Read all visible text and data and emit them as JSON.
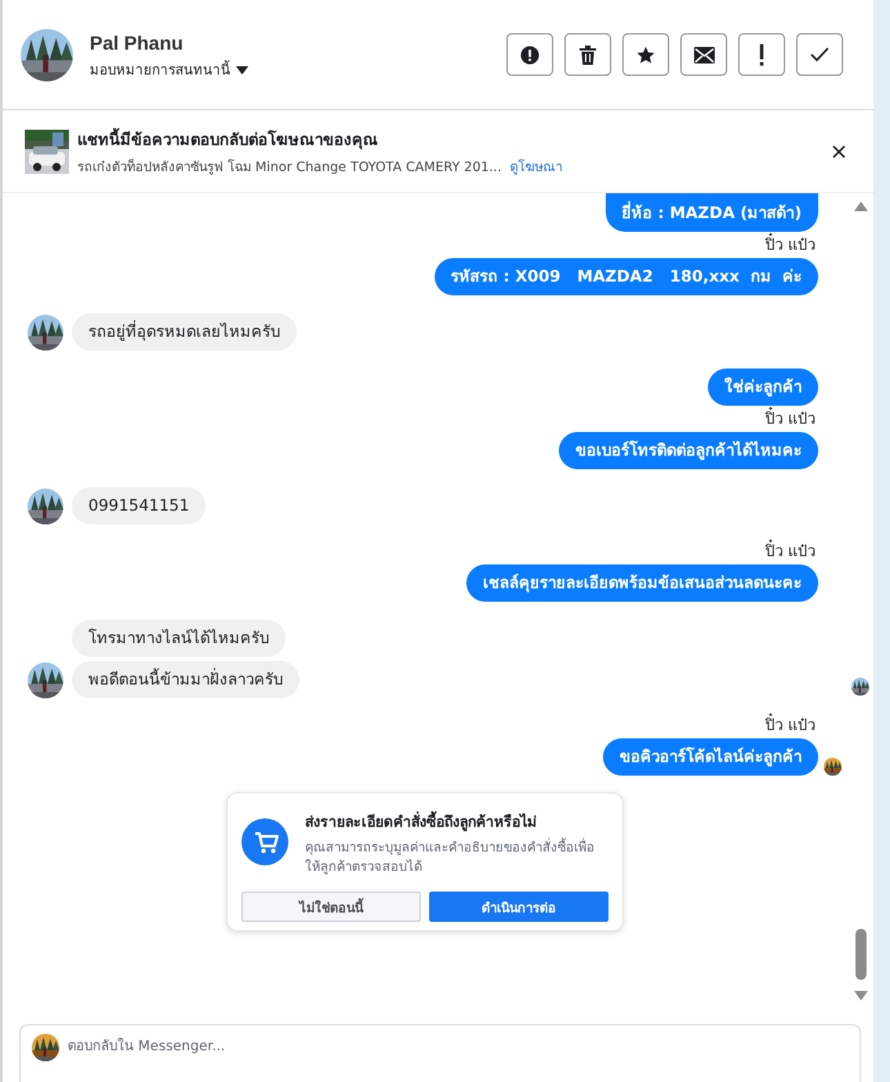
{
  "header": {
    "name": "Pal Phanu",
    "assign_label": "มอบหมายการสนทนานี้",
    "actions": [
      {
        "kind": "report"
      },
      {
        "kind": "delete"
      },
      {
        "kind": "star"
      },
      {
        "kind": "mail"
      },
      {
        "kind": "important"
      },
      {
        "kind": "done"
      }
    ]
  },
  "ad_banner": {
    "title": "แชทนี้มีข้อความตอบกลับต่อโฆษณาของคุณ",
    "description": "รถเก๋งตัวท็อปหลังคาซันรูฟ โฉม Minor Change TOYOTA CAMERY 201...",
    "link": "ดูโฆษณา"
  },
  "messages": [
    {
      "kind": "out",
      "text": "ยี่ห้อ : MAZDA (มาสด้า)"
    },
    {
      "kind": "out",
      "sender": "ปิ๋ว แป๋ว",
      "text": "รหัสรถ : X009   MAZDA2   180,xxx  กม  ค่ะ"
    },
    {
      "kind": "in",
      "avatar": true,
      "text": "รถอยู่ที่อุดรหมดเลยไหมครับ"
    },
    {
      "kind": "out",
      "text": "ใช่ค่ะลูกค้า"
    },
    {
      "kind": "out",
      "sender": "ปิ๋ว แป๋ว",
      "text": "ขอเบอร์โทรติดต่อลูกค้าได้ไหมคะ"
    },
    {
      "kind": "in",
      "avatar": true,
      "text": "0991541151"
    },
    {
      "kind": "out",
      "sender": "ปิ๋ว แป๋ว",
      "text": "เชลล์คุยรายละเอียดพร้อมข้อเสนอส่วนลดนะคะ"
    },
    {
      "kind": "in",
      "avatar": false,
      "text": "โทรมาทางไลน์ได้ไหมครับ"
    },
    {
      "kind": "in",
      "avatar": true,
      "seen": true,
      "text": "พอดีตอนนี้ข้ามมาฝั่งลาวครับ"
    },
    {
      "kind": "out",
      "sender": "ปิ๋ว แป๋ว",
      "agent_avatar": true,
      "text": "ขอคิวอาร์โค้ดไลน์ค่ะลูกค้า"
    }
  ],
  "order_prompt": {
    "title": "ส่งรายละเอียดคำสั่งซื้อถึงลูกค้าหรือไม่",
    "description": "คุณสามารถระบุมูลค่าและคำอธิบายของคำสั่งซื้อเพื่อให้ลูกค้าตรวจสอบได้",
    "buttons": [
      {
        "kind": "secondary",
        "label": "ไม่ใช่ตอนนี้"
      },
      {
        "kind": "primary",
        "label": "ดำเนินการต่อ"
      }
    ]
  },
  "composer": {
    "placeholder": "ตอบกลับใน Messenger..."
  }
}
